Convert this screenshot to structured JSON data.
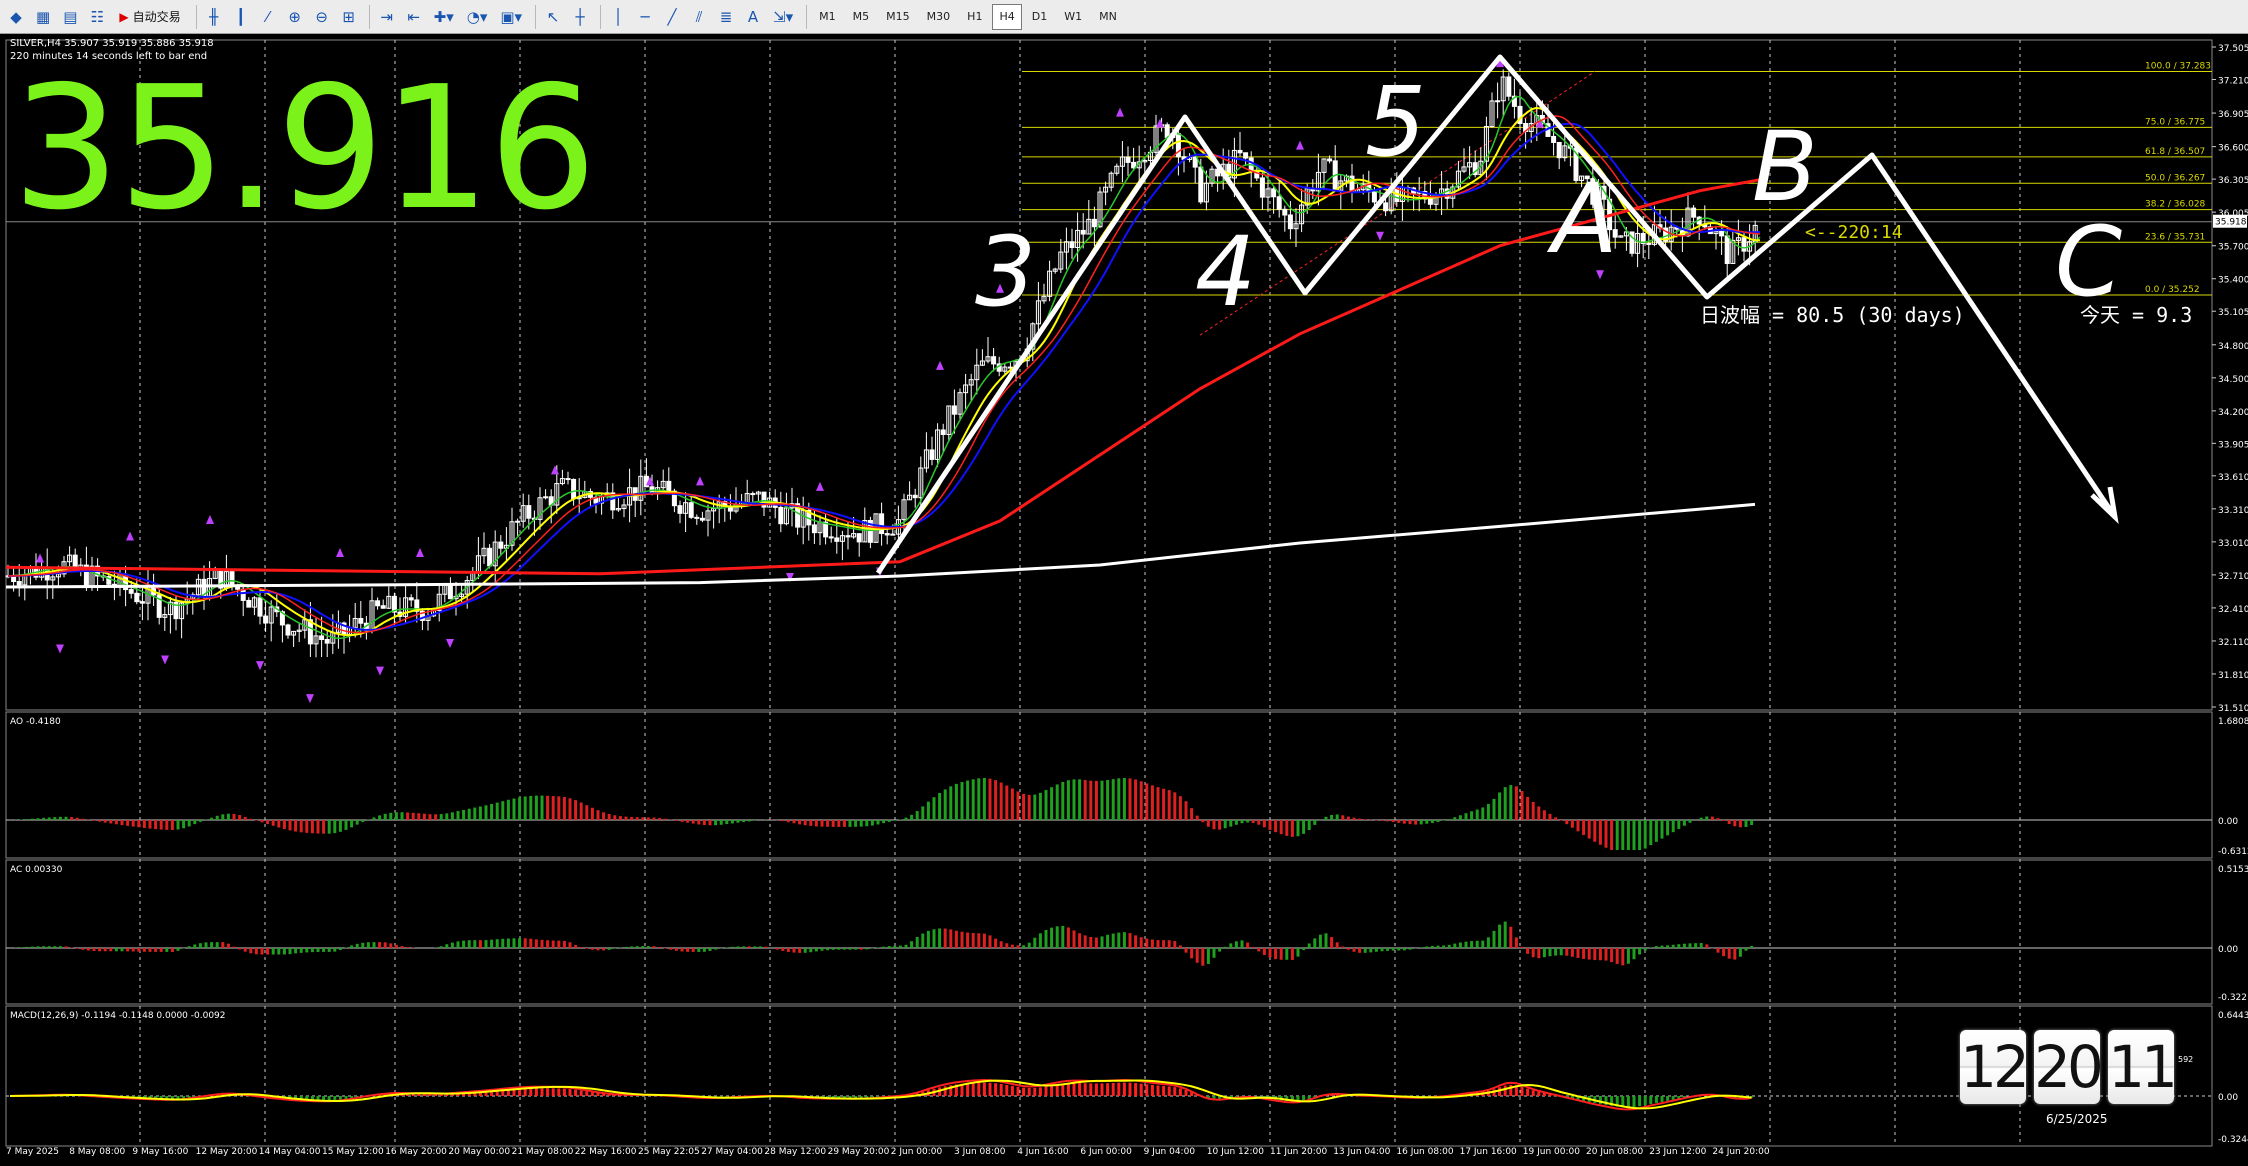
{
  "toolbar": {
    "auto_trade_label": "自动交易",
    "timeframes": [
      "M1",
      "M5",
      "M15",
      "M30",
      "H1",
      "H4",
      "D1",
      "W1",
      "MN"
    ],
    "active_timeframe": "H4"
  },
  "chart": {
    "symbol_header": "SILVER,H4  35.907 35.919 35.886 35.918",
    "countdown": "220 minutes 14 seconds left to bar end",
    "big_price": "35.916",
    "big_price_color": "#7cf21b",
    "current_price_tag": "35.918",
    "price_axis_labels": [
      "37.505",
      "37.210",
      "36.905",
      "36.600",
      "36.305",
      "36.005",
      "35.700",
      "35.400",
      "35.105",
      "34.800",
      "34.500",
      "34.200",
      "33.905",
      "33.610",
      "33.310",
      "33.010",
      "32.710",
      "32.410",
      "32.110",
      "31.810",
      "31.510"
    ],
    "time_axis_labels": [
      "7 May 2025",
      "8 May 08:00",
      "9 May 16:00",
      "12 May 20:00",
      "14 May 04:00",
      "15 May 12:00",
      "16 May 20:00",
      "20 May 00:00",
      "21 May 08:00",
      "22 May 16:00",
      "25 May 22:05",
      "27 May 04:00",
      "28 May 12:00",
      "29 May 20:00",
      "2 Jun 00:00",
      "3 Jun 08:00",
      "4 Jun 16:00",
      "6 Jun 00:00",
      "9 Jun 04:00",
      "10 Jun 12:00",
      "11 Jun 20:00",
      "13 Jun 04:00",
      "16 Jun 08:00",
      "17 Jun 16:00",
      "19 Jun 00:00",
      "20 Jun 08:00",
      "23 Jun 12:00",
      "24 Jun 20:00"
    ],
    "fib_levels": [
      {
        "label": "100.0 / 37.283",
        "price": 37.283
      },
      {
        "label": "75.0 / 36.775",
        "price": 36.775
      },
      {
        "label": "61.8 / 36.507",
        "price": 36.507
      },
      {
        "label": "50.0 / 36.267",
        "price": 36.267
      },
      {
        "label": "38.2 / 36.028",
        "price": 36.028
      },
      {
        "label": "23.6 / 35.731",
        "price": 35.731
      },
      {
        "label": "0.0 / 35.252",
        "price": 35.252
      }
    ],
    "bar_timer_label": "<--220:14",
    "daily_range_text": "日波幅 = 80.5  (30 days)",
    "today_text": "今天 = 9.3",
    "wave_labels": [
      "3",
      "4",
      "5",
      "A",
      "B",
      "C"
    ],
    "colors": {
      "ma_fast": "#29c829",
      "ma_signal": "#ffff00",
      "ma_mid": "#1010ff",
      "ma_slow": "#ff1a1a",
      "ma_long": "#ffffff",
      "candle": "#ffffff",
      "arrow": "#c040ff",
      "fib": "#d8d800",
      "grid": "#c8c8c8",
      "ao_up": "#1fa01f",
      "ao_down": "#dd2020"
    }
  },
  "ao": {
    "label": "AO -0.4180",
    "scale_top": "1.6808",
    "zero": "0.00",
    "scale_bottom": "-0.6312"
  },
  "ac": {
    "label": "AC 0.00330",
    "scale_top": "0.5153",
    "zero": "0.00",
    "scale_bottom": "-0.3221"
  },
  "macd": {
    "label": "MACD(12,26,9) -0.1194 -0.1148 0.0000 -0.0092",
    "scale_top": "0.6443",
    "zero": "0.00",
    "scale_bottom": "-0.3244"
  },
  "clock": {
    "hours": "12",
    "minutes": "20",
    "seconds": "11",
    "seconds_small": "592",
    "date": "6/25/2025"
  }
}
